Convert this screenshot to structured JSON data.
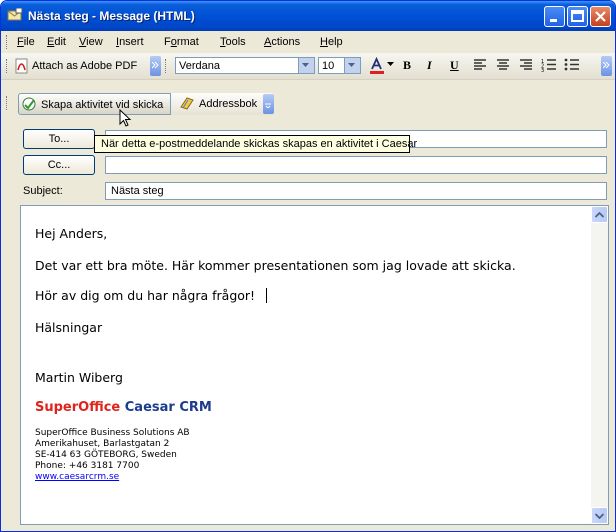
{
  "window": {
    "title": "Nästa steg - Message (HTML)"
  },
  "menu": [
    {
      "label": "File",
      "u": "F",
      "rest": "ile"
    },
    {
      "label": "Edit",
      "u": "E",
      "rest": "dit"
    },
    {
      "label": "View",
      "u": "V",
      "rest": "iew"
    },
    {
      "label": "Insert",
      "u": "I",
      "rest": "nsert"
    },
    {
      "label": "Format",
      "u": "o",
      "pre": "F",
      "rest": "rmat"
    },
    {
      "label": "Tools",
      "u": "T",
      "rest": "ools"
    },
    {
      "label": "Actions",
      "u": "A",
      "rest": "ctions"
    },
    {
      "label": "Help",
      "u": "H",
      "rest": "elp"
    }
  ],
  "toolbar": {
    "attach_pdf": "Attach as Adobe PDF",
    "font": "Verdana",
    "size": "10",
    "bold": "B",
    "italic": "I",
    "underline": "U"
  },
  "caesar_toolbar": {
    "create_activity": "Skapa aktivitet vid skicka",
    "address_book": "Addressbok"
  },
  "tooltip": "När detta e-postmeddelande skickas skapas en aktivitet i Caesar",
  "headers": {
    "to_button": "To...",
    "cc_button": "Cc...",
    "subject_label": "Subject:",
    "to_value": "",
    "cc_value": "",
    "subject_value": "Nästa steg"
  },
  "message": {
    "greeting": "Hej Anders,",
    "line1": "Det var ett bra möte. Här kommer presentationen som jag lovade att skicka.",
    "line2": "Hör av dig om du har några frågor!",
    "closing": "Hälsningar",
    "sender": "Martin Wiberg",
    "logo_part1": "SuperOffice",
    "logo_part2": "Caesar CRM",
    "company": "SuperOffice Business Solutions AB",
    "address1": "Amerikahuset, Barlastgatan 2",
    "address2": "SE-414 63  GÖTEBORG, Sweden",
    "phone": "Phone: +46 3181 7700",
    "website": "www.caesarcrm.se"
  },
  "colors": {
    "titlebar": "#0050d6",
    "logo_red": "#e0231b",
    "logo_blue": "#1e3c8c",
    "link": "#0000ff"
  }
}
